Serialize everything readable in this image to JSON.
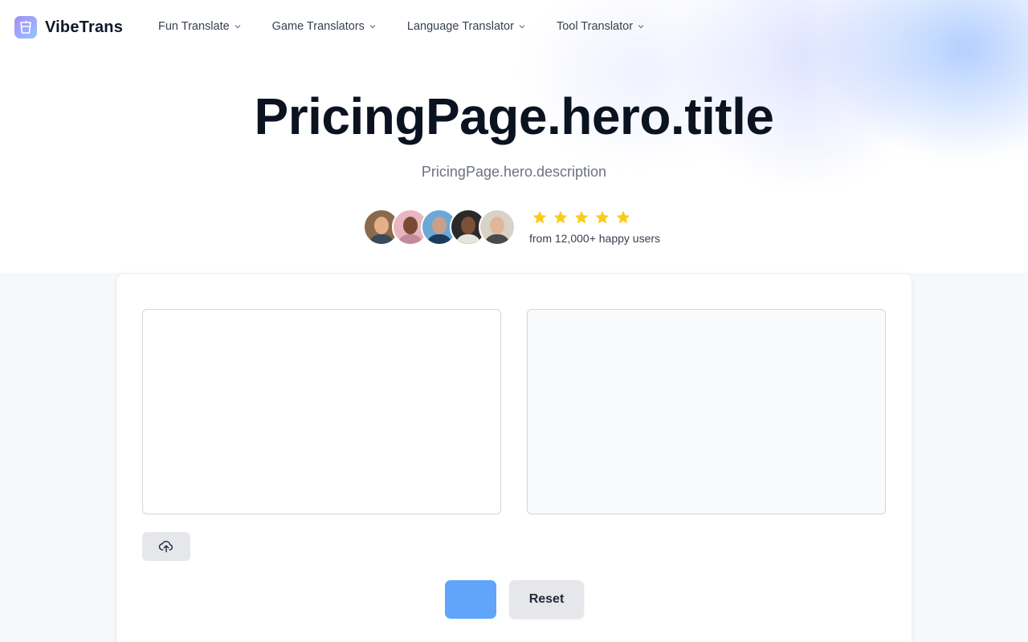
{
  "brand": {
    "name": "VibeTrans",
    "logo_icon": "cup-icon"
  },
  "nav": {
    "items": [
      {
        "label": "Fun Translate"
      },
      {
        "label": "Game Translators"
      },
      {
        "label": "Language Translator"
      },
      {
        "label": "Tool Translator"
      }
    ]
  },
  "hero": {
    "title": "PricingPage.hero.title",
    "description": "PricingPage.hero.description"
  },
  "social_proof": {
    "avatar_count": 5,
    "rating_stars": 5,
    "text": "from 12,000+ happy users"
  },
  "translator": {
    "input_placeholder": "",
    "output_value": "",
    "upload_icon": "upload-cloud-icon",
    "translate_label": "",
    "reset_label": "Reset"
  },
  "colors": {
    "accent": "#60a5fa",
    "star": "#facc15",
    "title": "#0b1220",
    "muted": "#6b7280"
  }
}
